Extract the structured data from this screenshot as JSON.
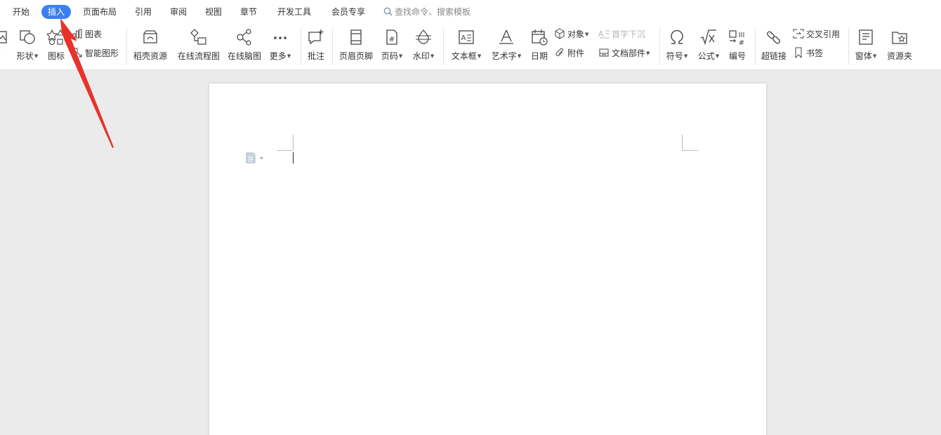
{
  "tabs": {
    "kaishi": "开始",
    "charu": "插入",
    "yemianbuju": "页面布局",
    "yinyong": "引用",
    "shenyue": "审阅",
    "shitu": "视图",
    "zhangjie": "章节",
    "kaifagongju": "开发工具",
    "huiyuanzhuanxiang": "会员专享"
  },
  "search": {
    "placeholder": "查找命令、搜索模板"
  },
  "ribbon": {
    "xingzhuang": "形状",
    "tubiao_icon": "图标",
    "tubiao_chart": "图表",
    "zhinengtuxing": "智能图形",
    "daokeziyuan": "稻壳资源",
    "zaixianliuchengtu": "在线流程图",
    "zaixiannaotu": "在线脑图",
    "gengduo": "更多",
    "pizhu": "批注",
    "yemeiyejiao": "页眉页脚",
    "yema": "页码",
    "shuiyin": "水印",
    "wenbenkuang": "文本框",
    "yishuzi": "艺术字",
    "riqi": "日期",
    "duixiang": "对象",
    "fujian": "附件",
    "shouzixiachen": "首字下沉",
    "wendangbujian": "文档部件",
    "fuhao": "符号",
    "gongshi": "公式",
    "bianhao": "编号",
    "chaolianjie": "超链接",
    "jiaochayinyong": "交叉引用",
    "shuqian": "书签",
    "chuangti": "窗体",
    "ziyuanjia": "资源夹"
  },
  "colors": {
    "accent": "#3b7ff0",
    "annotation_arrow": "#e8322a"
  },
  "icons": [
    "picture-icon",
    "shape-icon",
    "icon-library-icon",
    "chart-icon",
    "smart-art-icon",
    "docer-resource-icon",
    "flowchart-icon",
    "mindmap-icon",
    "more-icon",
    "comment-icon",
    "header-footer-icon",
    "page-number-icon",
    "watermark-icon",
    "textbox-icon",
    "wordart-icon",
    "date-icon",
    "object-icon",
    "attachment-icon",
    "drop-cap-icon",
    "doc-parts-icon",
    "symbol-icon",
    "formula-icon",
    "numbering-icon",
    "hyperlink-icon",
    "cross-reference-icon",
    "bookmark-icon",
    "form-icon",
    "resource-folder-icon",
    "search-icon",
    "page-icon"
  ]
}
